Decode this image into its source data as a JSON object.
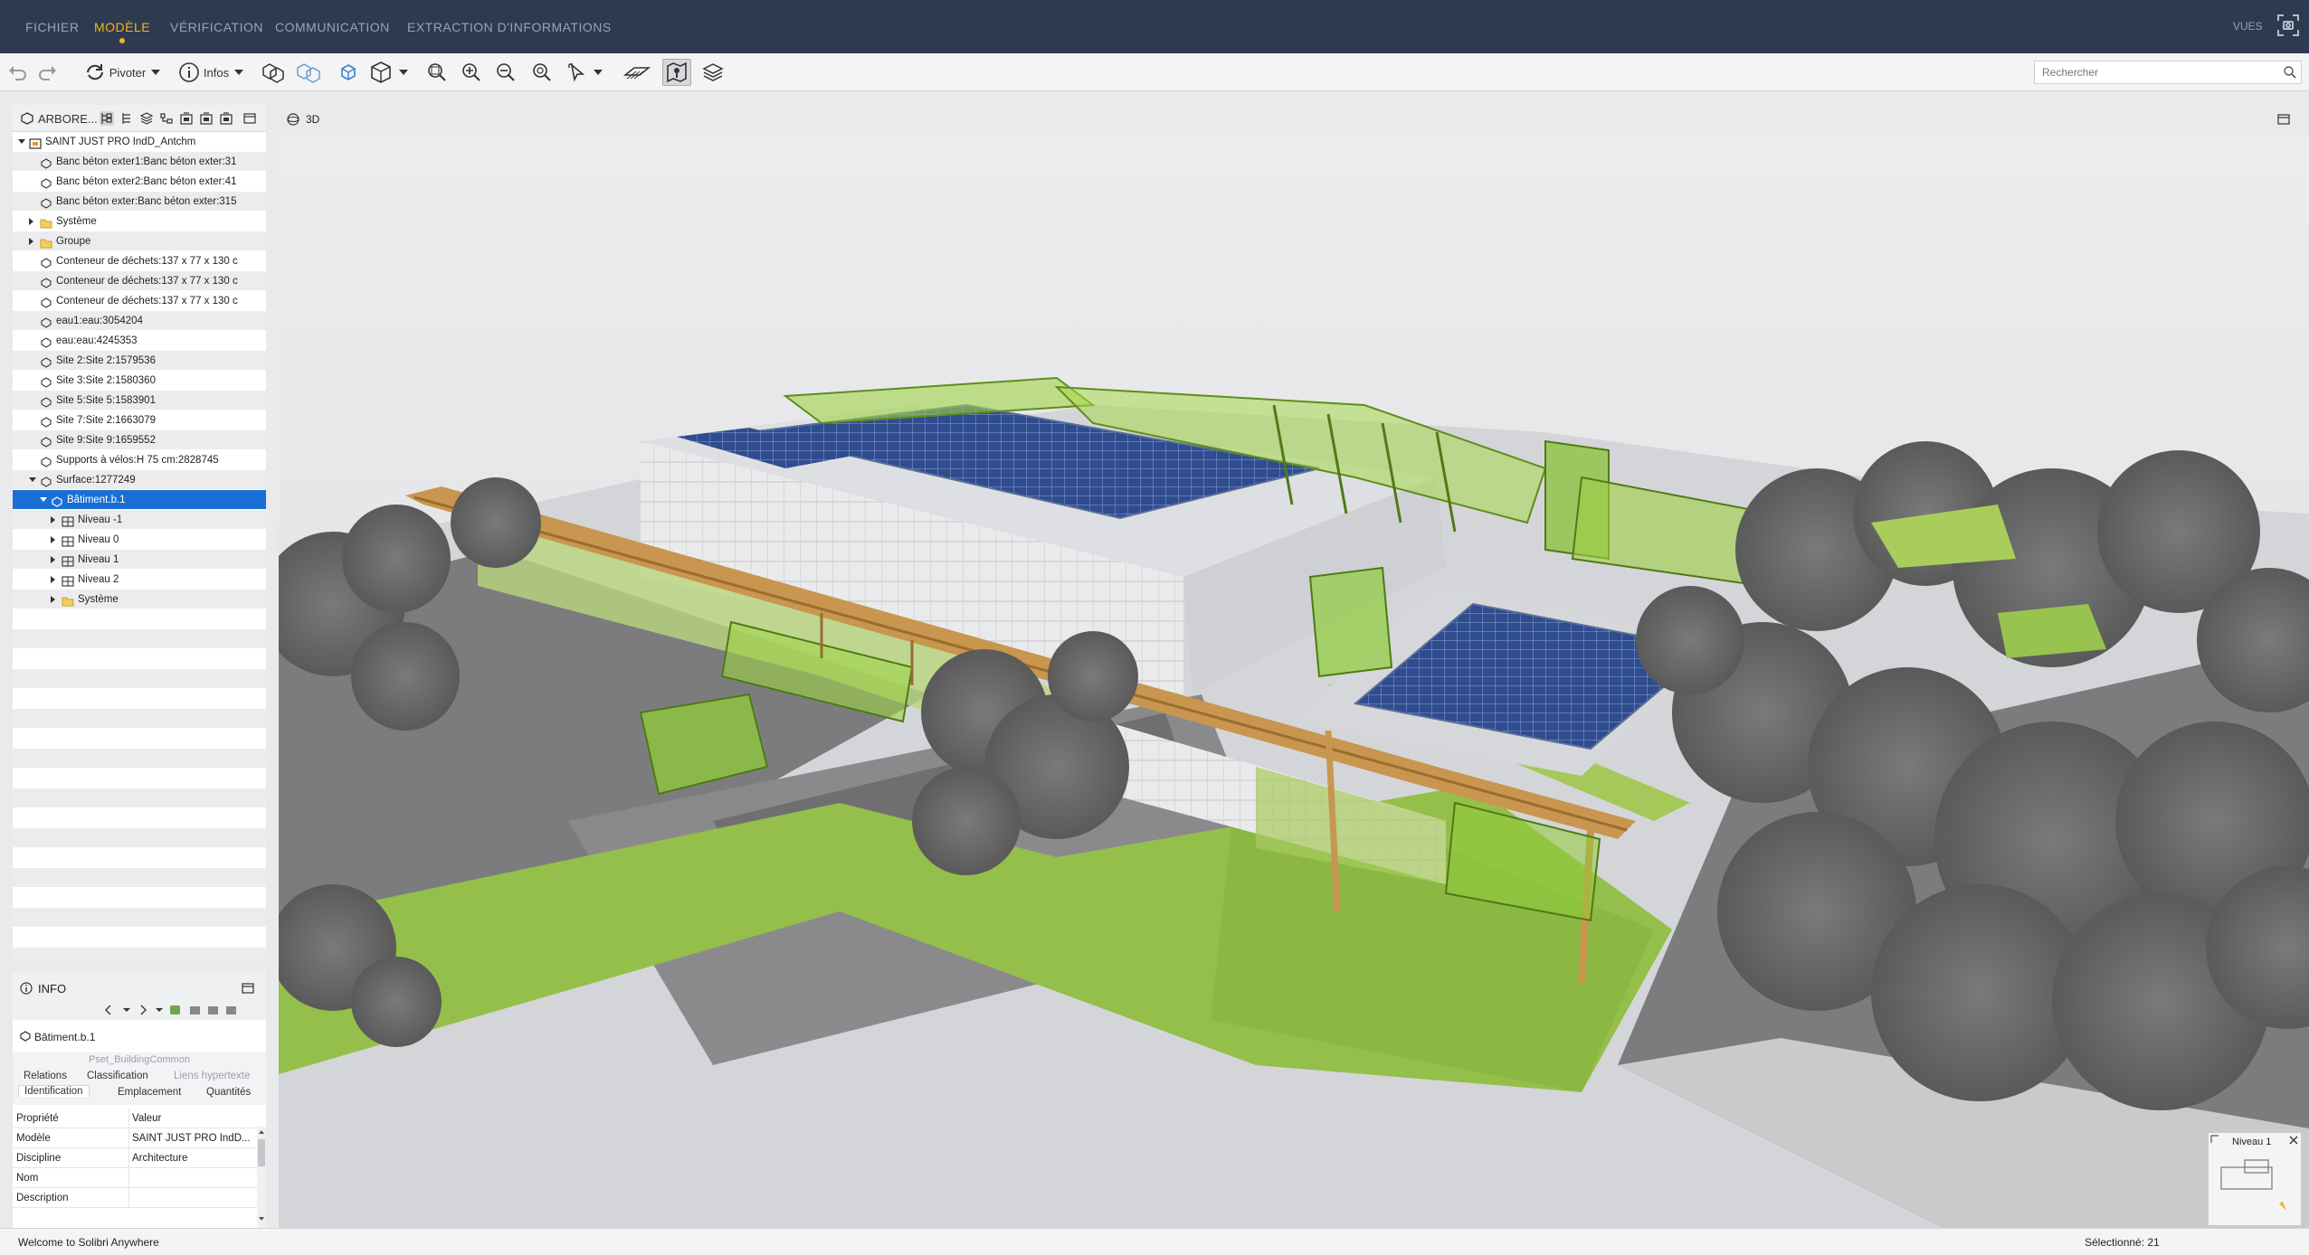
{
  "menu": {
    "items": [
      "FICHIER",
      "MODÈLE",
      "VÉRIFICATION",
      "COMMUNICATION",
      "EXTRACTION D'INFORMATIONS"
    ],
    "active": "MODÈLE",
    "right_label": "VUES"
  },
  "toolbar": {
    "rotate_label": "Pivoter",
    "info_label": "Infos",
    "search_placeholder": "Rechercher"
  },
  "tree": {
    "title": "ARBORE...",
    "rows": [
      {
        "label": "SAINT JUST PRO IndD_Antchm",
        "level": 0,
        "expander": "down",
        "icon": "model-icon"
      },
      {
        "label": "Banc béton exter1:Banc béton exter:31",
        "level": 1,
        "expander": "",
        "icon": "object-icon"
      },
      {
        "label": "Banc béton exter2:Banc béton exter:41",
        "level": 1,
        "expander": "",
        "icon": "object-icon"
      },
      {
        "label": "Banc béton exter:Banc béton exter:315",
        "level": 1,
        "expander": "",
        "icon": "object-icon"
      },
      {
        "label": "Système",
        "level": 1,
        "expander": "right",
        "icon": "folder-icon"
      },
      {
        "label": "Groupe",
        "level": 1,
        "expander": "right",
        "icon": "folder-icon"
      },
      {
        "label": "Conteneur de déchets:137 x 77 x 130 c",
        "level": 1,
        "expander": "",
        "icon": "object-icon"
      },
      {
        "label": "Conteneur de déchets:137 x 77 x 130 c",
        "level": 1,
        "expander": "",
        "icon": "object-icon"
      },
      {
        "label": "Conteneur de déchets:137 x 77 x 130 c",
        "level": 1,
        "expander": "",
        "icon": "object-icon"
      },
      {
        "label": "eau1:eau:3054204",
        "level": 1,
        "expander": "",
        "icon": "object-icon"
      },
      {
        "label": "eau:eau:4245353",
        "level": 1,
        "expander": "",
        "icon": "object-icon"
      },
      {
        "label": "Site 2:Site 2:1579536",
        "level": 1,
        "expander": "",
        "icon": "object-icon"
      },
      {
        "label": "Site 3:Site 2:1580360",
        "level": 1,
        "expander": "",
        "icon": "object-icon"
      },
      {
        "label": "Site 5:Site 5:1583901",
        "level": 1,
        "expander": "",
        "icon": "object-icon"
      },
      {
        "label": "Site 7:Site 2:1663079",
        "level": 1,
        "expander": "",
        "icon": "object-icon"
      },
      {
        "label": "Site 9:Site 9:1659552",
        "level": 1,
        "expander": "",
        "icon": "object-icon"
      },
      {
        "label": "Supports à vélos:H 75 cm:2828745",
        "level": 1,
        "expander": "",
        "icon": "object-icon"
      },
      {
        "label": "Surface:1277249",
        "level": 1,
        "expander": "down",
        "icon": "object-icon"
      },
      {
        "label": "Bâtiment.b.1",
        "level": 2,
        "expander": "down",
        "icon": "building-icon",
        "selected": true
      },
      {
        "label": "Niveau -1",
        "level": 3,
        "expander": "right",
        "icon": "level-icon"
      },
      {
        "label": "Niveau 0",
        "level": 3,
        "expander": "right",
        "icon": "level-icon"
      },
      {
        "label": "Niveau 1",
        "level": 3,
        "expander": "right",
        "icon": "level-icon"
      },
      {
        "label": "Niveau 2",
        "level": 3,
        "expander": "right",
        "icon": "level-icon"
      },
      {
        "label": "Système",
        "level": 3,
        "expander": "right",
        "icon": "folder-icon"
      }
    ]
  },
  "info": {
    "title": "INFO",
    "entity": "Bâtiment.b.1",
    "pset": "Pset_BuildingCommon",
    "tabs_row1": [
      "Relations",
      "Classification",
      "Liens hypertexte"
    ],
    "tabs_row2": [
      "Identification",
      "Emplacement",
      "Quantités"
    ],
    "active_tab": "Identification",
    "columns": [
      "Propriété",
      "Valeur"
    ],
    "properties": [
      {
        "key": "Modèle",
        "value": "SAINT JUST PRO IndD..."
      },
      {
        "key": "Discipline",
        "value": "Architecture"
      },
      {
        "key": "Nom",
        "value": ""
      },
      {
        "key": "Description",
        "value": ""
      }
    ]
  },
  "view": {
    "title": "3D"
  },
  "minimap": {
    "label": "Niveau 1"
  },
  "status": {
    "left": "Welcome to Solibri Anywhere",
    "right": "Sélectionné: 21"
  },
  "colors": {
    "menubar_bg": "#2e3a4f",
    "menu_active": "#f2b521",
    "selection": "#1a6fd4",
    "glass_green": "#8fd13a",
    "solar_blue": "#2e4a8a",
    "timber": "#c8964e"
  }
}
